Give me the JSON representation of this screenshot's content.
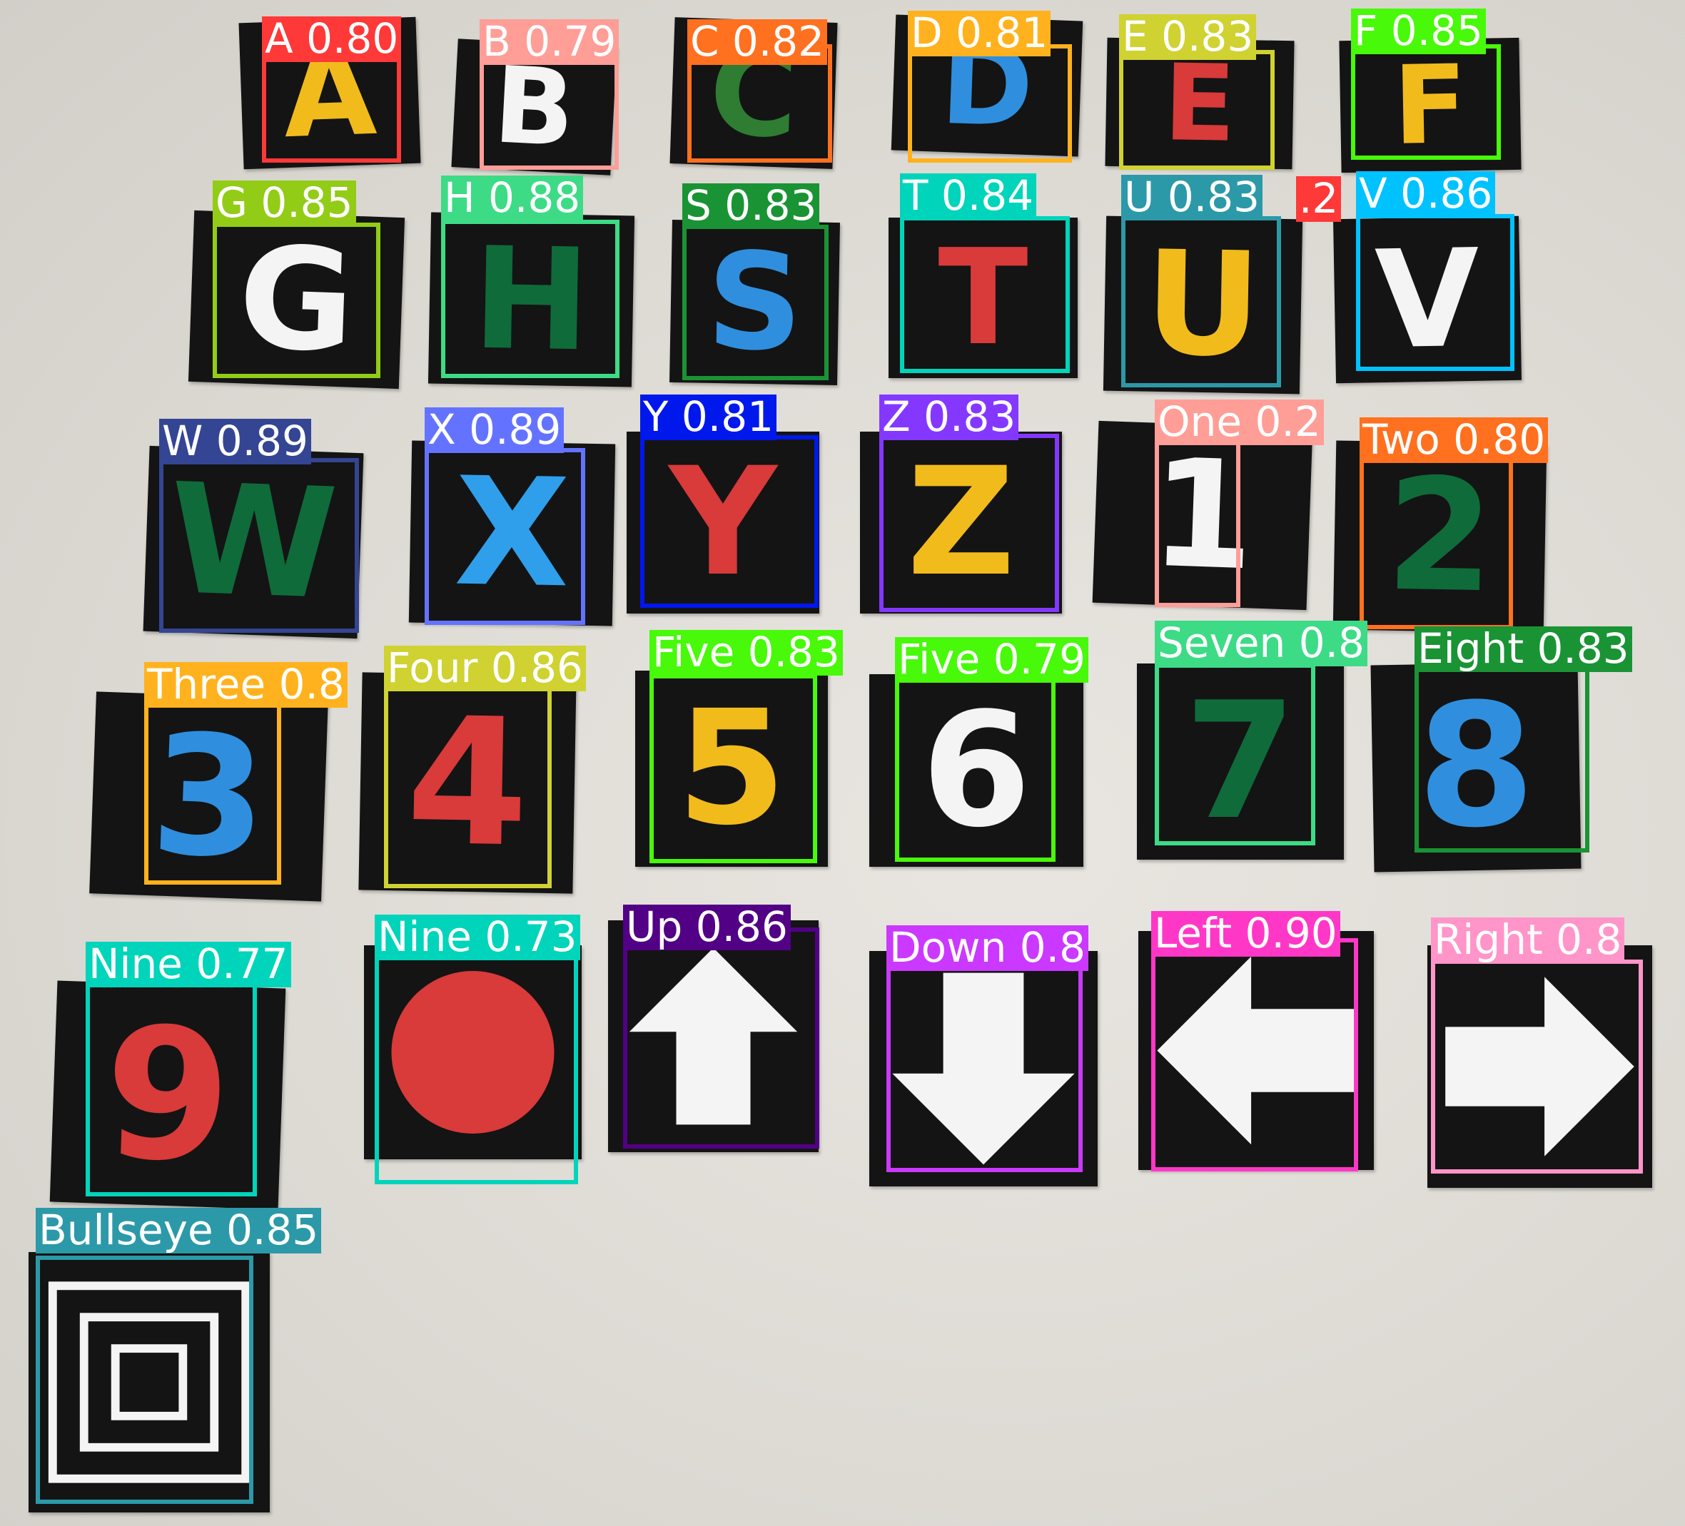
{
  "detections": [
    {
      "label": "A 0.80",
      "color": "#ff3838",
      "glyph": "A",
      "glyph_color": "#f2bb1c",
      "rot": -2
    },
    {
      "label": "B 0.79",
      "color": "#ff9d97",
      "glyph": "B",
      "glyph_color": "#f4f4f4",
      "rot": 3
    },
    {
      "label": "C 0.82",
      "color": "#ff701f",
      "glyph": "C",
      "glyph_color": "#2e7d32",
      "rot": 2
    },
    {
      "label": "D 0.81",
      "color": "#ffb21d",
      "glyph": "D",
      "glyph_color": "#2f8fde",
      "rot": 2
    },
    {
      "label": "E 0.83",
      "color": "#cfd231",
      "glyph": "E",
      "glyph_color": "#d93a3a",
      "rot": 1
    },
    {
      "label": "F 0.85",
      "color": "#48f90a",
      "glyph": "F",
      "glyph_color": "#f2bb1c",
      "rot": -1
    },
    {
      "label": "G 0.85",
      "color": "#92cc17",
      "glyph": "G",
      "glyph_color": "#f4f4f4",
      "rot": 2
    },
    {
      "label": "H 0.88",
      "color": "#3ddb86",
      "glyph": "H",
      "glyph_color": "#0f6b3a",
      "rot": 1
    },
    {
      "label": "S 0.83",
      "color": "#1a9334",
      "glyph": "S",
      "glyph_color": "#2f8fde",
      "rot": 1
    },
    {
      "label": "T 0.84",
      "color": "#00d4bb",
      "glyph": "T",
      "glyph_color": "#d93a3a",
      "rot": 0
    },
    {
      "label": "U 0.83",
      "color": "#2c99a8",
      "glyph": "U",
      "glyph_color": "#f2bb1c",
      "rot": 1
    },
    {
      "label": ".2",
      "color": "#ff3838",
      "glyph": "",
      "glyph_color": "#ffffff",
      "rot": 0
    },
    {
      "label": "V 0.86",
      "color": "#00c2ff",
      "glyph": "V",
      "glyph_color": "#f4f4f4",
      "rot": -1
    },
    {
      "label": "W 0.89",
      "color": "#344593",
      "glyph": "W",
      "glyph_color": "#0f6b3a",
      "rot": 2
    },
    {
      "label": "X 0.89",
      "color": "#6473ff",
      "glyph": "X",
      "glyph_color": "#2f9fec",
      "rot": 1
    },
    {
      "label": "Y 0.81",
      "color": "#0018ec",
      "glyph": "Y",
      "glyph_color": "#d93a3a",
      "rot": 0
    },
    {
      "label": "Z 0.83",
      "color": "#8438ff",
      "glyph": "Z",
      "glyph_color": "#f2bb1c",
      "rot": 0
    },
    {
      "label": "One 0.2",
      "color": "#ff9d97",
      "glyph": "1",
      "glyph_color": "#f4f4f4",
      "rot": 2
    },
    {
      "label": "Two 0.80",
      "color": "#ff701f",
      "glyph": "2",
      "glyph_color": "#0f6b3a",
      "rot": 1
    },
    {
      "label": "Three 0.8",
      "color": "#ffb21d",
      "glyph": "3",
      "glyph_color": "#2f8fde",
      "rot": 2
    },
    {
      "label": "Four 0.86",
      "color": "#cfd231",
      "glyph": "4",
      "glyph_color": "#d93a3a",
      "rot": 1
    },
    {
      "label": "Five 0.83",
      "color": "#48f90a",
      "glyph": "5",
      "glyph_color": "#f2bb1c",
      "rot": 0
    },
    {
      "label": "Five 0.79",
      "color": "#48f90a",
      "glyph": "6",
      "glyph_color": "#f4f4f4",
      "rot": 0
    },
    {
      "label": "Seven 0.8",
      "color": "#3ddb86",
      "glyph": "7",
      "glyph_color": "#0f6b3a",
      "rot": 0
    },
    {
      "label": "Eight 0.83",
      "color": "#1a9334",
      "glyph": "8",
      "glyph_color": "#2f8fde",
      "rot": -1
    },
    {
      "label": "Nine 0.77",
      "color": "#00d4bb",
      "glyph": "9",
      "glyph_color": "#d93a3a",
      "rot": 2
    },
    {
      "label": "Nine 0.73",
      "color": "#00d4bb",
      "glyph": "circle",
      "glyph_color": "#d93a3a",
      "rot": 0
    },
    {
      "label": "Up 0.86",
      "color": "#520085",
      "glyph": "arrow-up",
      "glyph_color": "#f4f4f4",
      "rot": 0
    },
    {
      "label": "Down 0.8",
      "color": "#cb38ff",
      "glyph": "arrow-down",
      "glyph_color": "#f4f4f4",
      "rot": 0
    },
    {
      "label": "Left 0.90",
      "color": "#ff37c7",
      "glyph": "arrow-left",
      "glyph_color": "#f4f4f4",
      "rot": 0
    },
    {
      "label": "Right 0.8",
      "color": "#ff95c8",
      "glyph": "arrow-right",
      "glyph_color": "#f4f4f4",
      "rot": 0
    },
    {
      "label": "Bullseye 0.85",
      "color": "#2c99a8",
      "glyph": "bullseye",
      "glyph_color": "#f4f4f4",
      "rot": 0
    }
  ]
}
